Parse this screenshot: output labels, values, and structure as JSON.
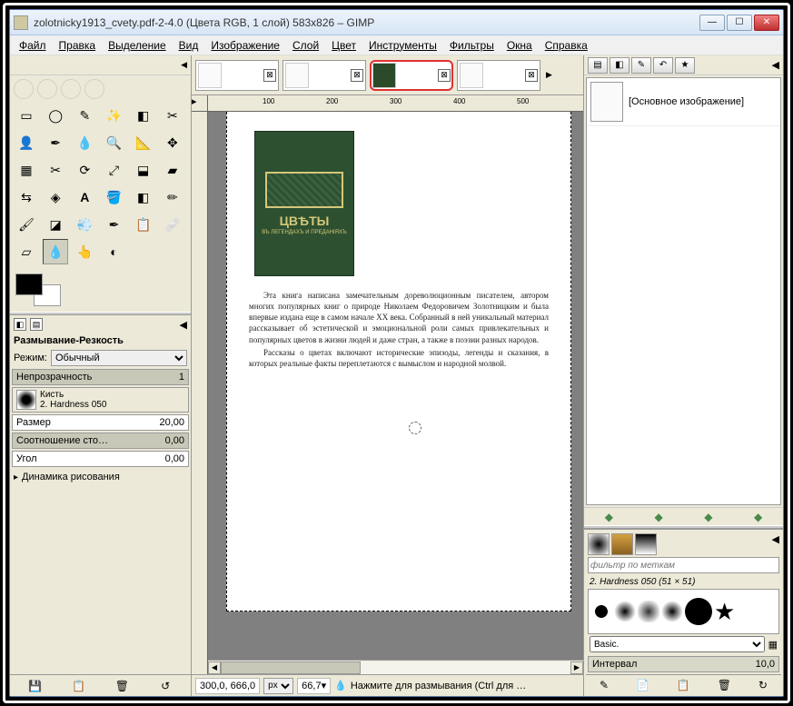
{
  "window": {
    "title": "zolotnicky1913_cvety.pdf-2-4.0 (Цвета RGB, 1 слой) 583x826 – GIMP"
  },
  "menu": {
    "file": "Файл",
    "edit": "Правка",
    "select": "Выделение",
    "view": "Вид",
    "image": "Изображение",
    "layer": "Слой",
    "colors": "Цвет",
    "tools": "Инструменты",
    "filters": "Фильтры",
    "windows": "Окна",
    "help": "Справка"
  },
  "tool_options": {
    "title": "Размывание-Резкость",
    "mode_label": "Режим:",
    "mode_value": "Обычный",
    "opacity_label": "Непрозрачность",
    "opacity_value": "1",
    "brush_label": "Кисть",
    "brush_name": "2. Hardness 050",
    "size_label": "Размер",
    "size_value": "20,00",
    "ratio_label": "Соотношение сто…",
    "ratio_value": "0,00",
    "angle_label": "Угол",
    "angle_value": "0,00",
    "dynamics_label": "Динамика рисования"
  },
  "layers": {
    "main_label": "[Основное изображение]"
  },
  "brushes": {
    "filter_placeholder": "фильтр по меткам",
    "current": "2. Hardness 050 (51 × 51)",
    "preset": "Basic.",
    "spacing_label": "Интервал",
    "spacing_value": "10,0"
  },
  "status": {
    "b": "300,0, 666,0",
    "unit": "px",
    "zoom": "66,7",
    "hint": "Нажмите для размывания (Ctrl для …"
  },
  "ruler_marks": {
    "r100": "100",
    "r200": "200",
    "r300": "300",
    "r400": "400",
    "r500": "500"
  },
  "page_text": {
    "book_title": "ЦВѢТЫ",
    "book_sub": "ВЪ ЛЕГЕНДАХЪ И ПРЕДАНІЯХЪ",
    "p1": "Эта книга написана замечательным дореволюционным писателем, автором многих популярных книг о природе Николаем Федоровичем Золотницким и была впервые издана еще в самом начале XX века. Собранный в ней уникальный материал рассказывает об эстетической и эмоциональной роли самых привлекательных и популярных цветов в жизни людей и даже стран, а также в поэзии разных народов.",
    "p2": "Рассказы о цветах включают исторические эпизоды, легенды и сказания, в которых реальные факты переплетаются с вымыслом и народной молвой."
  }
}
